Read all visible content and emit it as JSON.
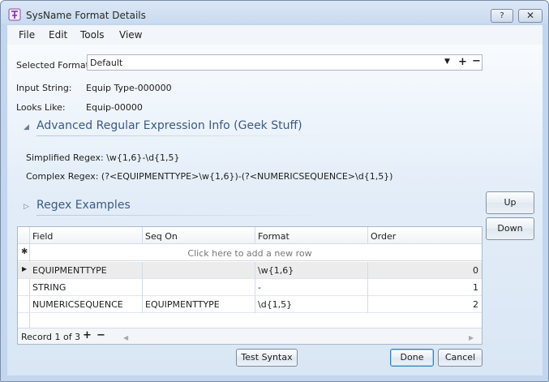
{
  "window": {
    "title": "SysName Format Details",
    "help_label": "?",
    "close_label": "✕"
  },
  "menu": [
    "File",
    "Edit",
    "Tools",
    "View"
  ],
  "selected_format": {
    "label": "Selected Format:",
    "value": "Default"
  },
  "input_string": {
    "label": "Input String:",
    "value": "Equip Type-000000"
  },
  "looks_like": {
    "label": "Looks Like:",
    "value": "Equip-00000"
  },
  "advanced": {
    "title": "Advanced Regular Expression Info (Geek Stuff)",
    "expanded": true,
    "simplified_regex": "Simplified Regex: \\w{1,6}-\\d{1,5}",
    "complex_regex": "Complex Regex: (?<EQUIPMENTTYPE>\\w{1,6})-(?<NUMERICSEQUENCE>\\d{1,5})"
  },
  "examples": {
    "title": "Regex Examples",
    "expanded": false
  },
  "side_buttons": {
    "up": "Up",
    "down": "Down"
  },
  "grid": {
    "columns": [
      "Field",
      "Seq On",
      "Format",
      "Order"
    ],
    "new_row_text": "Click here to add a new row",
    "rows": [
      {
        "field": "EQUIPMENTTYPE",
        "seq_on": "",
        "format": "\\w{1,6}",
        "order": "0"
      },
      {
        "field": "STRING",
        "seq_on": "",
        "format": "-",
        "order": "1"
      },
      {
        "field": "NUMERICSEQUENCE",
        "seq_on": "EQUIPMENTTYPE",
        "format": "\\d{1,5}",
        "order": "2"
      }
    ],
    "record_label": "Record 1 of 3"
  },
  "buttons": {
    "test_syntax": "Test Syntax",
    "done": "Done",
    "cancel": "Cancel"
  },
  "colors": {
    "section_title": "#3b5a86",
    "default_button_border": "#3c7fb1"
  }
}
